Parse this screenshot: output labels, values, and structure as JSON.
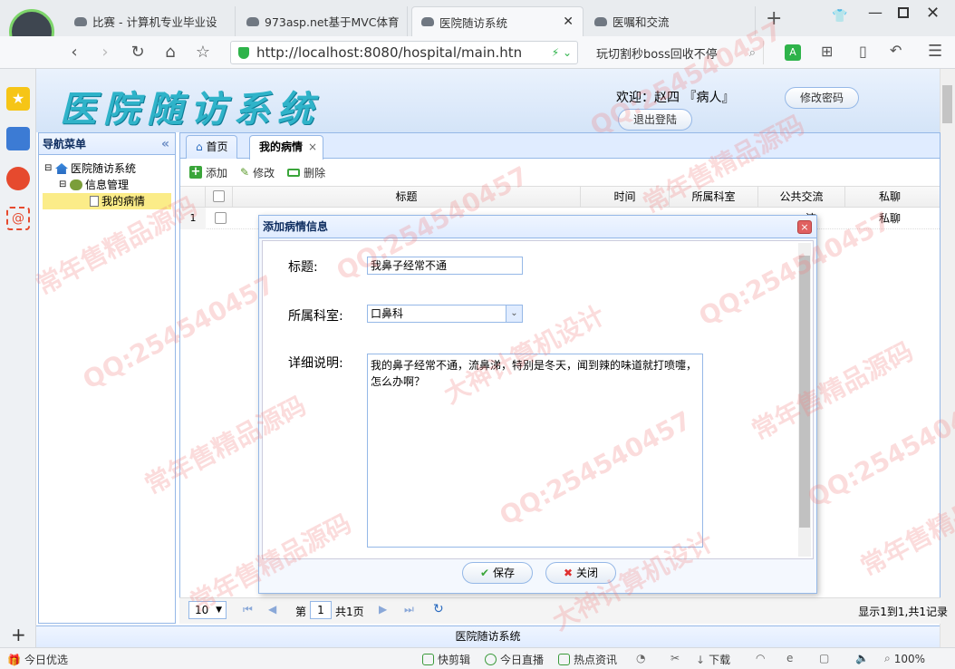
{
  "browser": {
    "tabs": [
      {
        "label": "比赛 - 计算机专业毕业设",
        "active": false
      },
      {
        "label": "973asp.net基于MVC体育",
        "active": false
      },
      {
        "label": "医院随访系统",
        "active": true
      },
      {
        "label": "医嘱和交流",
        "active": false
      }
    ],
    "new_tab": "+",
    "url": "http://localhost:8080/hospital/main.htn",
    "search_text": "玩切割秒boss回收不停"
  },
  "header": {
    "system_title": "医院随访系统",
    "welcome": "欢迎：赵四 『病人』",
    "change_password": "修改密码",
    "logout": "退出登陆"
  },
  "nav": {
    "title": "导航菜单",
    "collapse": "«",
    "tree": [
      {
        "label": "医院随访系统",
        "level": 0,
        "prefix": "⊟"
      },
      {
        "label": "信息管理",
        "level": 1,
        "prefix": "⊟"
      },
      {
        "label": "我的病情",
        "level": 2,
        "prefix": "",
        "selected": true
      }
    ]
  },
  "content": {
    "tabs": [
      {
        "label": "首页",
        "active": false
      },
      {
        "label": "我的病情",
        "active": true,
        "close": "×"
      }
    ],
    "toolbar": {
      "add": "添加",
      "edit": "修改",
      "delete": "删除"
    },
    "columns": [
      "标题",
      "时间",
      "所属科室",
      "公共交流",
      "私聊"
    ],
    "rows": [
      {
        "num": "1",
        "public_partial": "流",
        "private": "私聊"
      }
    ],
    "pager": {
      "page_size": "10",
      "page_label": "第",
      "page_value": "1",
      "total_pages": "共1页",
      "summary": "显示1到1,共1记录"
    }
  },
  "dialog": {
    "title": "添加病情信息",
    "close": "×",
    "fields": {
      "title_label": "标题:",
      "title_value": "我鼻子经常不通",
      "dept_label": "所属科室:",
      "dept_value": "口鼻科",
      "detail_label": "详细说明:",
      "detail_value": "我的鼻子经常不通，流鼻涕，特别是冬天，闻到辣的味道就打喷嚏，怎么办啊？"
    },
    "save": "保存",
    "cancel": "关闭"
  },
  "footer": {
    "text": "医院随访系统"
  },
  "statusbar": {
    "left": "今日优选",
    "items": [
      "快剪辑",
      "今日直播",
      "热点资讯"
    ],
    "download": "下载",
    "zoom": "100%"
  },
  "watermarks": [
    "常年售精品源码",
    "QQ:254540457",
    "大神计算机设计"
  ]
}
